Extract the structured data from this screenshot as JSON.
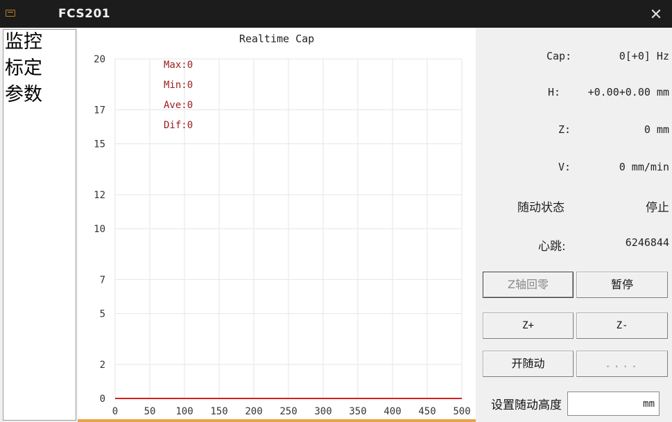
{
  "window": {
    "title": "FCS201",
    "close_glyph": "✕",
    "icon": "app-icon"
  },
  "nav": {
    "items": [
      {
        "label": "监控"
      },
      {
        "label": "标定"
      },
      {
        "label": "参数"
      }
    ]
  },
  "chart_data": {
    "type": "line",
    "title": "Realtime Cap",
    "xlabel": "",
    "ylabel": "",
    "xlim": [
      0,
      500
    ],
    "ylim": [
      0,
      20
    ],
    "x_ticks": [
      0,
      50,
      100,
      150,
      200,
      250,
      300,
      350,
      400,
      450,
      500
    ],
    "y_ticks": [
      0,
      2,
      5,
      7,
      10,
      12,
      15,
      17,
      20
    ],
    "grid": true,
    "series": [
      {
        "color": "#d62020",
        "x": [
          0,
          500
        ],
        "y": [
          0,
          0
        ]
      }
    ],
    "stats": [
      "Max:0",
      "Min:0",
      "Ave:0",
      "Dif:0"
    ],
    "stats_color": "#9b1c1c"
  },
  "readouts": [
    {
      "label": "Cap:",
      "value": "0[+0] Hz"
    },
    {
      "label": "H:",
      "value": "+0.00+0.00 mm"
    },
    {
      "label": "Z:",
      "value": "0 mm"
    },
    {
      "label": "V:",
      "value": "0 mm/min"
    },
    {
      "label": "随动状态",
      "value": "停止"
    },
    {
      "label": "心跳:",
      "value": "6246844"
    }
  ],
  "buttons": {
    "z_home": "Z轴回零",
    "pause": "暂停",
    "z_plus": "Z+",
    "z_minus": "Z-",
    "start_follow": "开随动",
    "more": "...."
  },
  "follow_height": {
    "label": "设置随动高度",
    "value": "",
    "unit": "mm"
  }
}
